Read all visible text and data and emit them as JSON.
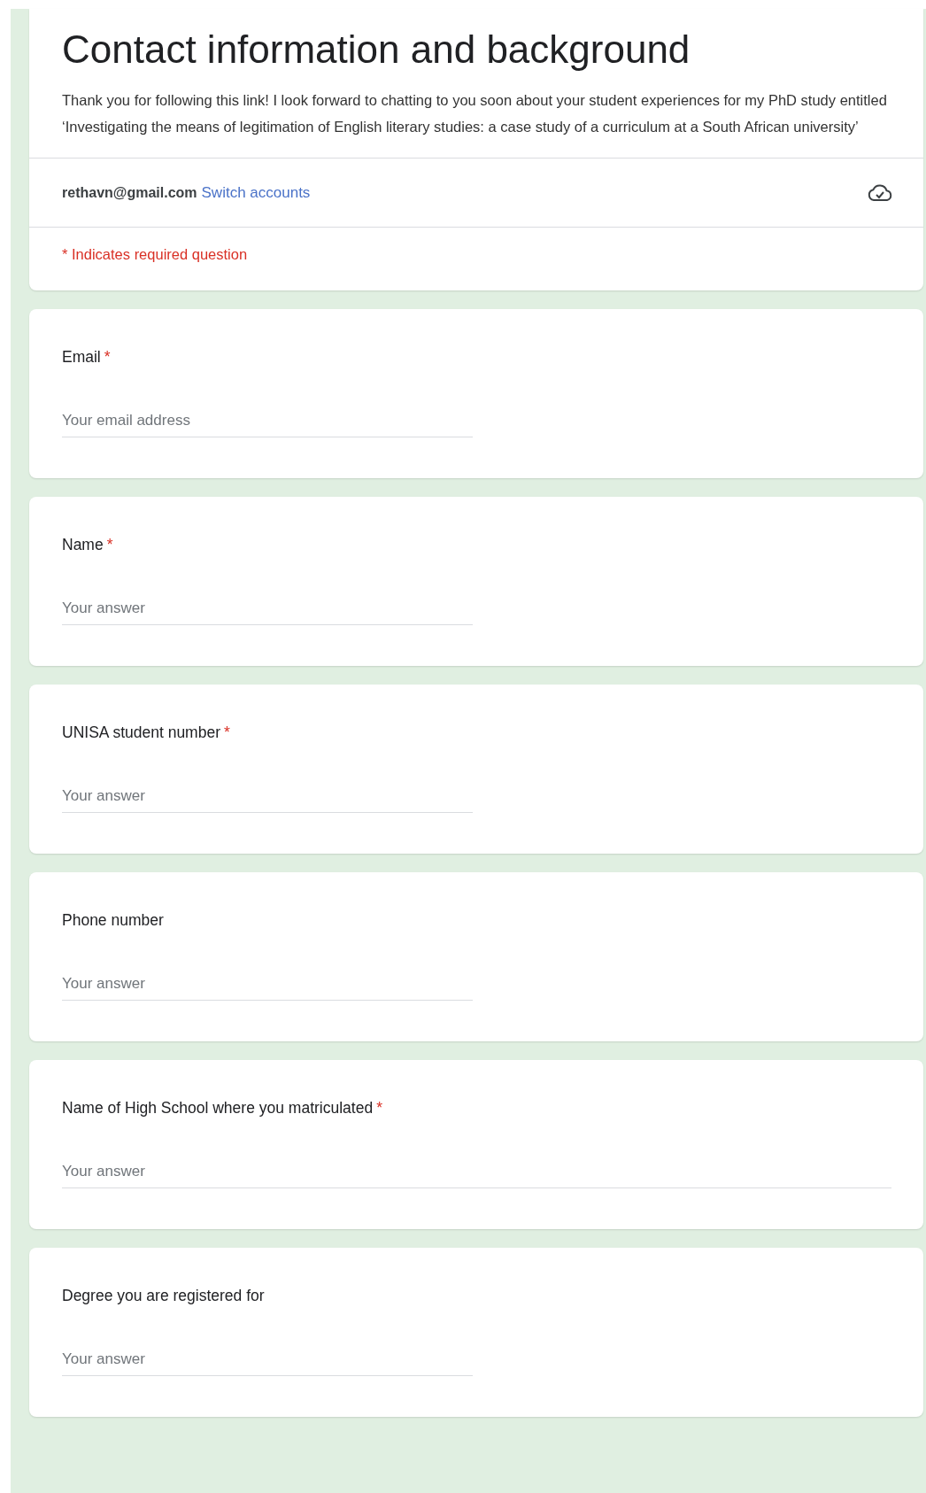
{
  "header": {
    "title": "Contact information and background",
    "description": "Thank you for following this link! I look forward to chatting to you soon about your student experiences for my PhD study entitled ‘Investigating the means of legitimation of English literary studies: a case study of a curriculum at a South African university’",
    "account": {
      "email": "rethavn@gmail.com",
      "switch_link": "Switch accounts"
    },
    "required_note": "* Indicates required question"
  },
  "questions": [
    {
      "label": "Email",
      "required_mark": "*",
      "kind": "short",
      "placeholder": "Your email address"
    },
    {
      "label": "Name",
      "required_mark": "*",
      "kind": "short",
      "placeholder": "Your answer"
    },
    {
      "label": "UNISA student number",
      "required_mark": "*",
      "kind": "short",
      "placeholder": "Your answer"
    },
    {
      "label": "Phone number",
      "kind": "short",
      "placeholder": "Your answer"
    },
    {
      "label": "Name of High School where you matriculated",
      "required_mark": "*",
      "kind": "paragraph",
      "placeholder": "Your answer"
    },
    {
      "label": "Degree you are registered for",
      "kind": "short",
      "placeholder": "Your answer"
    }
  ]
}
